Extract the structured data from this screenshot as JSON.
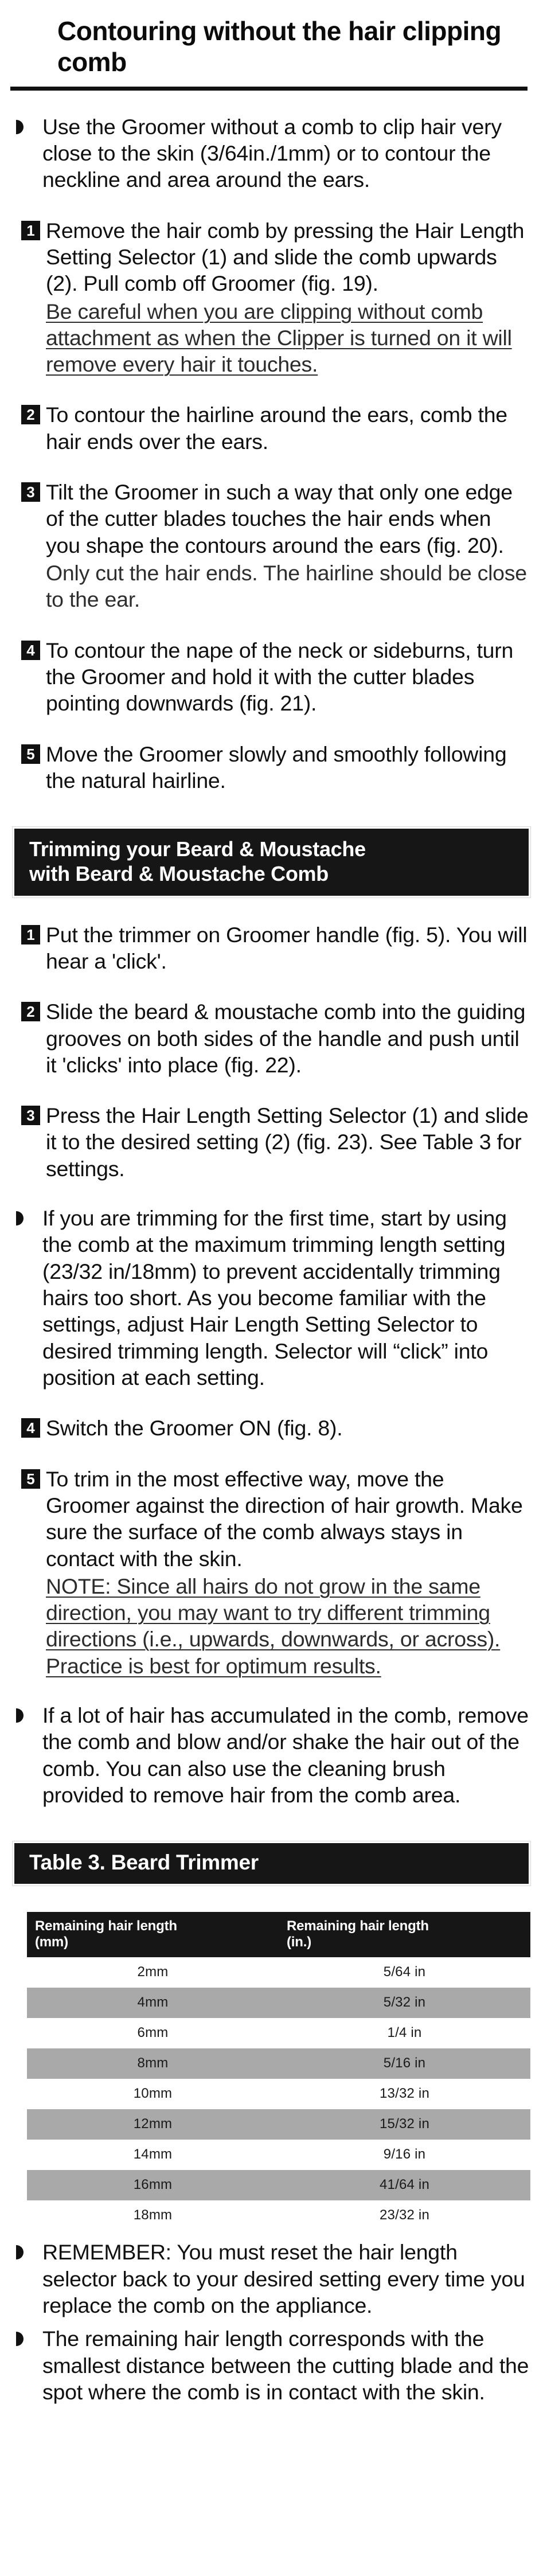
{
  "document": {
    "title": "Contouring without the hair clipping comb"
  },
  "section1": {
    "intro_bullet": "Use the Groomer without a comb to clip hair very close to the skin (3/64in./1mm) or to contour the neckline and area around the ears.",
    "steps": [
      {
        "number": "1",
        "text": "Remove the hair comb by pressing the Hair Length Setting Selector (1) and slide the comb upwards (2). Pull comb off Groomer (fig. 19).",
        "note": "Be careful when you are clipping without comb attachment as when the Clipper is turned on it will remove every hair it touches.",
        "note_style": "underlined"
      },
      {
        "number": "2",
        "text": "To contour the hairline around the ears, comb the hair ends over the ears."
      },
      {
        "number": "3",
        "text": "Tilt the Groomer in such a way that only one edge of the cutter blades touches the hair ends when you shape the contours around the ears (fig. 20).",
        "note": "Only cut the hair ends. The hairline should be close to the ear.",
        "note_style": "plain"
      },
      {
        "number": "4",
        "text": "To contour the nape of the neck or sideburns, turn the Groomer and hold it with the cutter blades pointing downwards (fig. 21)."
      },
      {
        "number": "5",
        "text": "Move the Groomer slowly and smoothly following the natural hairline."
      }
    ]
  },
  "section2": {
    "banner_line1": "Trimming your Beard & Moustache",
    "banner_line2": "with Beard & Moustache Comb",
    "steps": [
      {
        "number": "1",
        "text": "Put the trimmer on Groomer handle (fig. 5). You will hear a 'click'."
      },
      {
        "number": "2",
        "text": "Slide the beard & moustache comb into the guiding grooves on both sides of the handle and push until it 'clicks' into place (fig. 22)."
      },
      {
        "number": "3",
        "text": "Press the Hair Length Setting Selector (1) and slide it to the desired setting (2) (fig. 23). See Table 3 for settings."
      }
    ],
    "bullet_first_time": "If you are trimming for the first time, start by using the comb at the maximum trimming length setting (23/32 in/18mm) to prevent accidentally trimming hairs too short.  As you become familiar with the settings, adjust Hair Length Setting Selector to desired trimming length. Selector will “click” into position at each setting.",
    "step4": {
      "number": "4",
      "text": "Switch the Groomer ON (fig. 8)."
    },
    "step5": {
      "number": "5",
      "text": "To trim in the most effective way, move the Groomer against the direction of hair growth. Make sure the surface of the comb always stays in contact with the skin.",
      "note": "NOTE: Since all hairs do not grow in the same direction, you may want to try different trimming directions (i.e., upwards, downwards, or across). Practice is best for optimum results.",
      "note_style": "underlined"
    },
    "bullet_accumulated": "If a lot of hair has accumulated in the comb, remove the comb and blow and/or shake the hair out of the comb. You can also use the cleaning brush provided to remove hair from the comb area."
  },
  "table": {
    "caption": "Table 3. Beard Trimmer",
    "headers": [
      "Remaining hair length (mm)",
      "Remaining hair length (in.)"
    ],
    "header_mm_line1": "Remaining hair length",
    "header_mm_line2": "(mm)",
    "header_in_line1": "Remaining hair length",
    "header_in_line2": "(in.)",
    "rows": [
      {
        "mm": "2mm",
        "in": "5/64 in"
      },
      {
        "mm": "4mm",
        "in": "5/32 in"
      },
      {
        "mm": "6mm",
        "in": "1/4 in"
      },
      {
        "mm": "8mm",
        "in": "5/16 in"
      },
      {
        "mm": "10mm",
        "in": "13/32 in"
      },
      {
        "mm": "12mm",
        "in": "15/32 in"
      },
      {
        "mm": "14mm",
        "in": "9/16 in"
      },
      {
        "mm": "16mm",
        "in": "41/64 in"
      },
      {
        "mm": "18mm",
        "in": "23/32 in"
      }
    ]
  },
  "footer_bullets": [
    "REMEMBER: You must reset the hair length selector back to your desired setting every time you replace the comb on the appliance.",
    "The remaining hair length corresponds with the smallest distance between the cutting blade and the spot where the comb is in contact with the skin."
  ],
  "colors": {
    "ink": "#111111",
    "banner_bg": "#161616",
    "table_row_alt": "#a9a9a9",
    "paper": "#ffffff"
  }
}
